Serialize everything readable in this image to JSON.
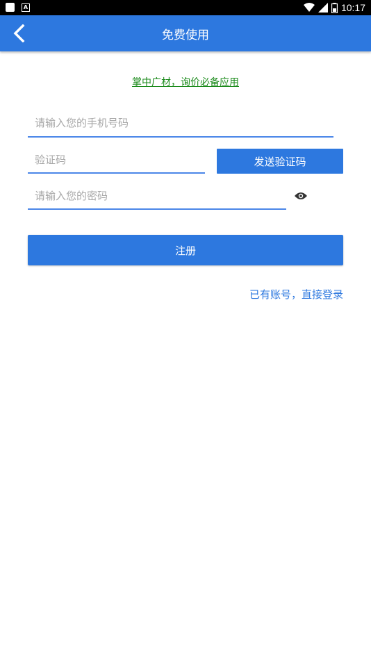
{
  "status_bar": {
    "time": "10:17"
  },
  "header": {
    "title": "免费使用"
  },
  "slogan": "掌中广材，询价必备应用",
  "form": {
    "phone_placeholder": "请输入您的手机号码",
    "code_placeholder": "验证码",
    "send_code_label": "发送验证码",
    "password_placeholder": "请输入您的密码",
    "register_label": "注册",
    "login_link": "已有账号，直接登录"
  },
  "icons": {
    "back": "chevron-left-icon",
    "visibility": "eye-icon"
  },
  "colors": {
    "primary": "#2d78df",
    "slogan": "#1a8a1a",
    "underline": "#4a86e8",
    "placeholder": "#a8a8a8"
  }
}
